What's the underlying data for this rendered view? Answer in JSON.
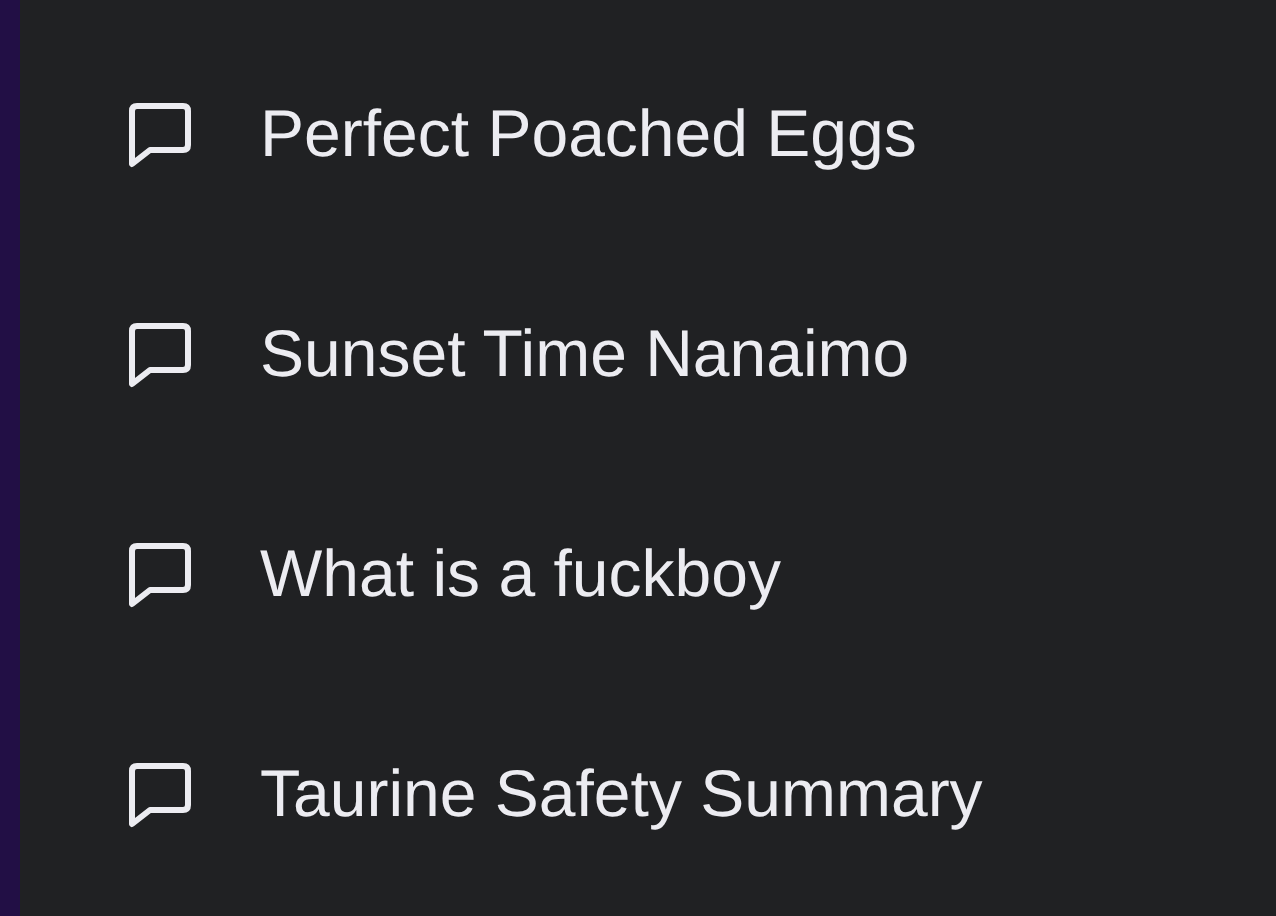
{
  "chats": [
    {
      "title": "Perfect Poached Eggs"
    },
    {
      "title": "Sunset Time Nanaimo"
    },
    {
      "title": "What is a fuckboy"
    },
    {
      "title": "Taurine Safety Summary"
    }
  ]
}
